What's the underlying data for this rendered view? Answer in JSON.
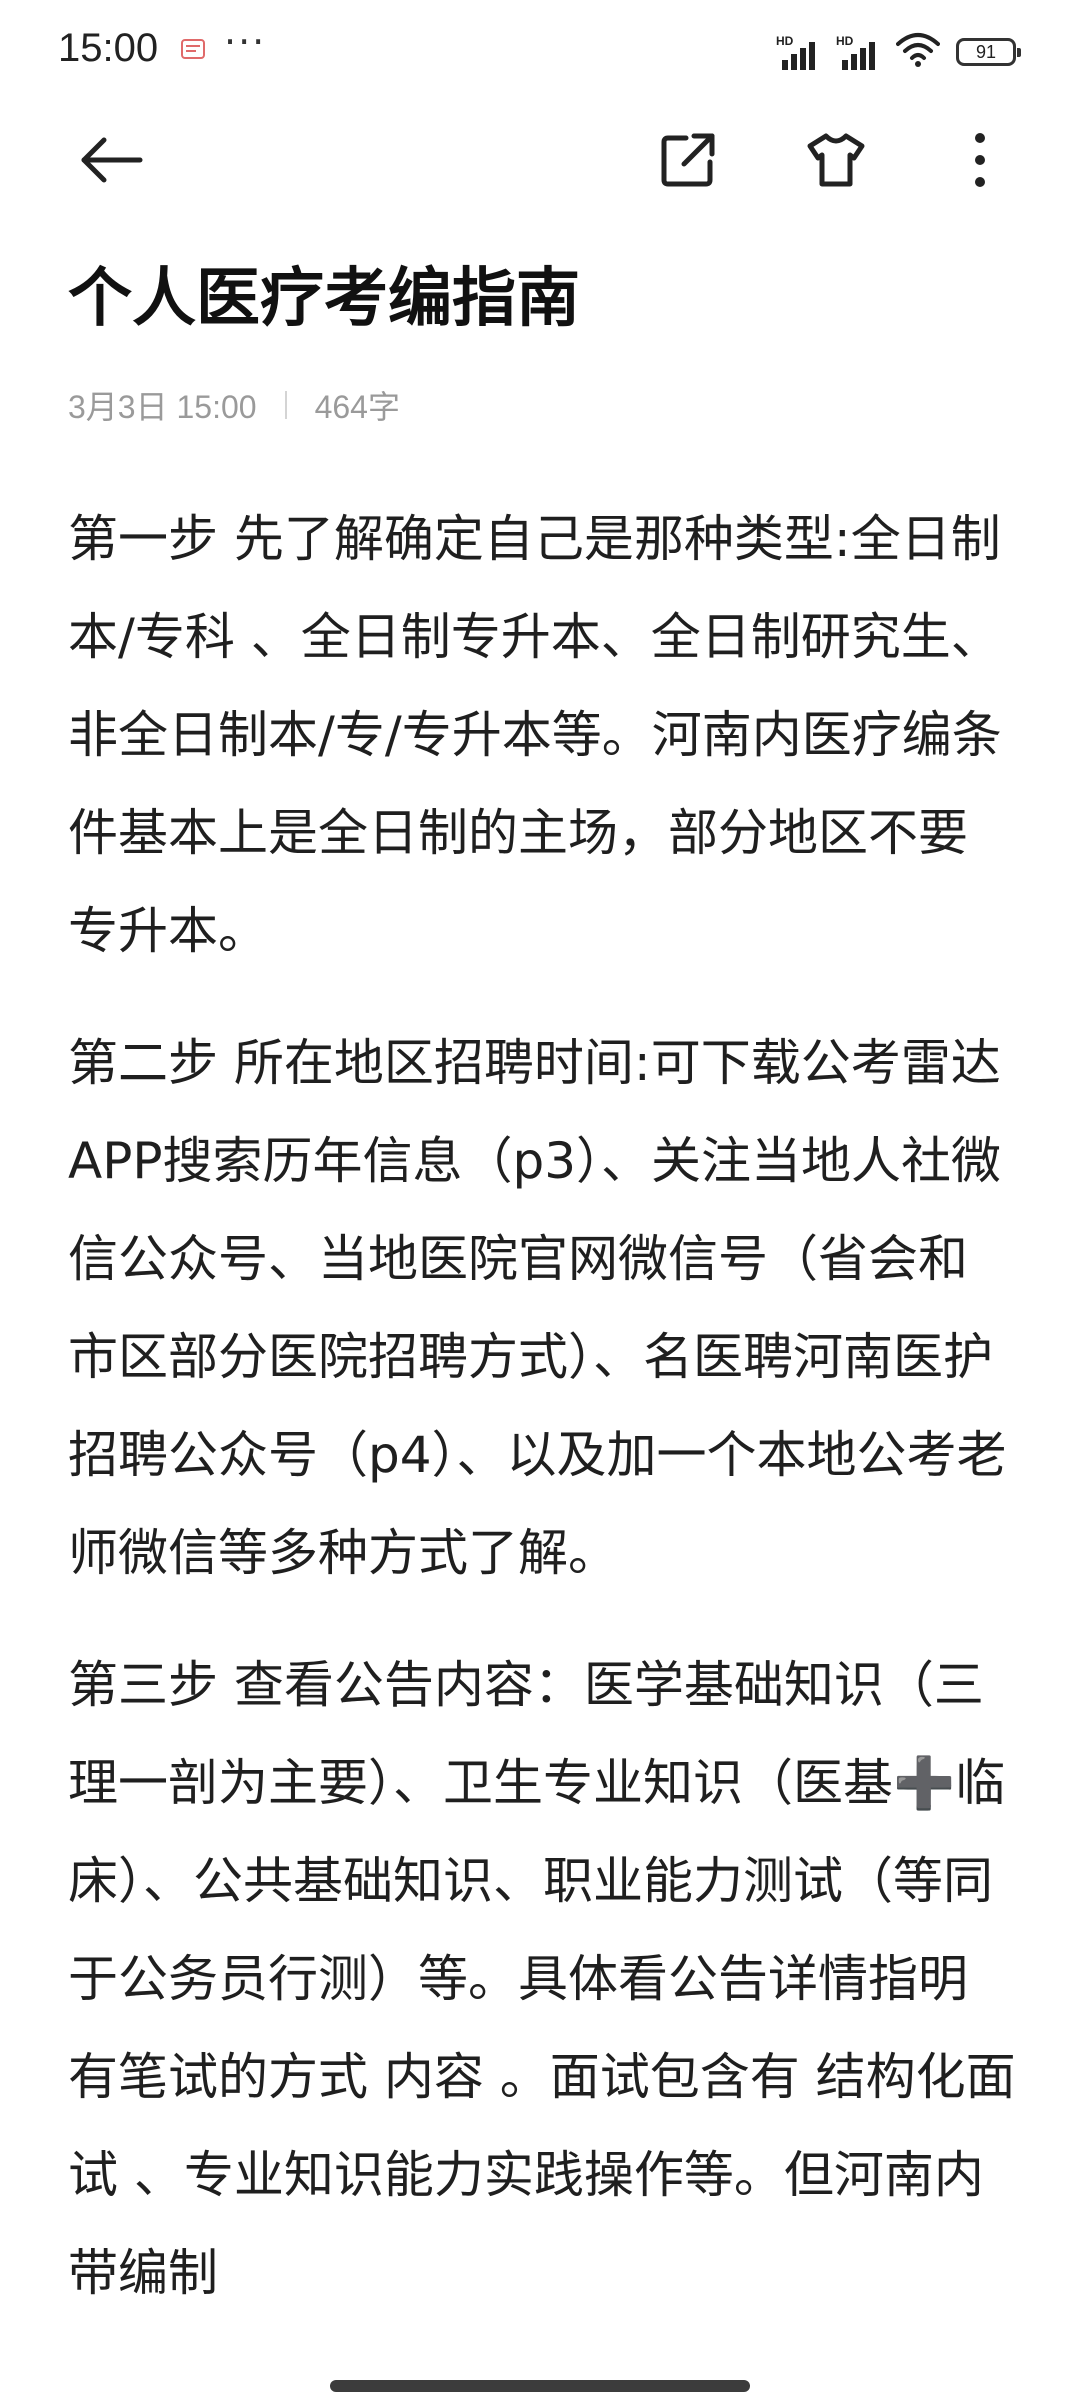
{
  "status_bar": {
    "time": "15:00",
    "more": "···",
    "signal_label_1": "HD",
    "signal_label_2": "HD",
    "battery": "91"
  },
  "toolbar": {
    "icons": [
      "back-arrow-icon",
      "share-icon",
      "theme-shirt-icon",
      "more-vertical-icon"
    ]
  },
  "note": {
    "title": "个人医疗考编指南",
    "date": "3月3日 15:00",
    "word_count": "464字",
    "paragraphs": [
      "第一步 先了解确定自己是那种类型:全日制本/专科 、全日制专升本、全日制研究生、非全日制本/专/专升本等。河南内医疗编条件基本上是全日制的主场，部分地区不要专升本。",
      "第二步 所在地区招聘时间:可下载公考雷达APP搜索历年信息（p3）、关注当地人社微信公众号、当地医院官网微信号（省会和市区部分医院招聘方式）、名医聘河南医护招聘公众号（p4）、以及加一个本地公考老师微信等多种方式了解。",
      "第三步 查看公告内容：医学基础知识（三理一剖为主要）、卫生专业知识（医基➕临床）、公共基础知识、职业能力测试（等同于公务员行测）等。具体看公告详情指明有笔试的方式 内容 。面试包含有 结构化面试 、专业知识能力实践操作等。但河南内带编制"
    ]
  }
}
